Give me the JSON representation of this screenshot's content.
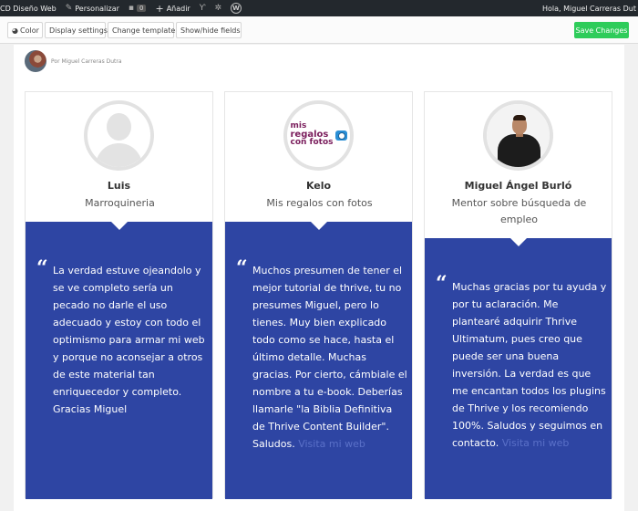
{
  "adminbar": {
    "site_name": "CD Diseño Web",
    "customize": "Personalizar",
    "comments_count": "0",
    "add_new": "Añadir",
    "greeting": "Hola, Miguel Carreras Dut"
  },
  "toolbar": {
    "color": "Color",
    "display_settings": "Display settings",
    "change_template": "Change template",
    "show_hide_fields": "Show/hide fields",
    "save": "Save Changes"
  },
  "post": {
    "author": "Por Miguel Carreras Dutra"
  },
  "testimonials": [
    {
      "name": "Luis",
      "role": "Marroquineria",
      "quote": "La verdad estuve ojeandolo y se ve completo sería un pecado no darle el uso adecuado y estoy con todo el optimismo para armar mi web y porque no aconsejar a otros de este material tan enriquecedor y completo. Gracias Miguel",
      "link": ""
    },
    {
      "name": "Kelo",
      "role": "Mis regalos con fotos",
      "quote": "Muchos presumen de tener el mejor tutorial de thrive, tu no presumes Miguel, pero lo tienes. Muy bien explicado todo como se hace, hasta el último detalle. Muchas gracias. Por cierto, cámbiale el nombre a tu e-book. Deberías llamarle \"la Biblia Definitiva de Thrive Content Builder\". Saludos.",
      "link": "Visita mi web",
      "logo": {
        "line1": "mis",
        "line2": "regalos",
        "line3": "con fotos"
      }
    },
    {
      "name": "Miguel Ángel Burló",
      "role": "Mentor sobre búsqueda de empleo",
      "quote": "Muchas gracias por tu ayuda y por tu aclaración. Me plantearé adquirir Thrive Ultimatum, pues creo que puede ser una buena inversión. La verdad es que me encantan todos los plugins de Thrive y los recomiendo 100%. Saludos y seguimos en contacto.",
      "link": "Visita mi web"
    }
  ],
  "colors": {
    "quote_bg": "#2e45a3",
    "save_button": "#2ecc5a",
    "adminbar": "#23282d"
  },
  "icons": [
    "wordpress-icon",
    "brush-icon",
    "comment-icon",
    "plus-icon",
    "yoast-icon",
    "gear-icon",
    "wp-logo-icon",
    "palette-icon",
    "quote-icon"
  ]
}
